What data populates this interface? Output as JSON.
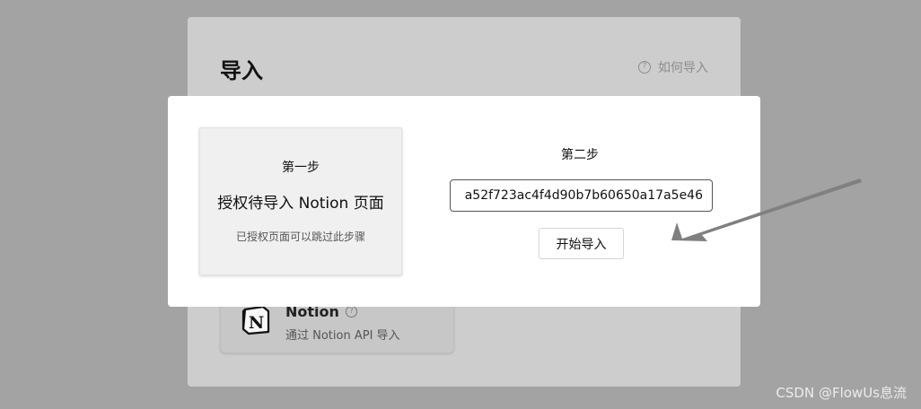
{
  "background_panel": {
    "title": "导入",
    "how_to_link": "如何导入",
    "help_glyph": "?",
    "notion_card": {
      "logo_letter": "N",
      "name": "Notion",
      "help_glyph": "?",
      "description": "通过 Notion API 导入"
    }
  },
  "modal": {
    "step1": {
      "label": "第一步",
      "heading": "授权待导入 Notion 页面",
      "note": "已授权页面可以跳过此步骤"
    },
    "step2": {
      "label": "第二步",
      "token_value": "a52f723ac4f4d90b7b60650a17a5e46",
      "start_button": "开始导入"
    }
  },
  "annotation": {
    "arrow_color": "#808080"
  },
  "watermark": "CSDN @FlowUs息流"
}
